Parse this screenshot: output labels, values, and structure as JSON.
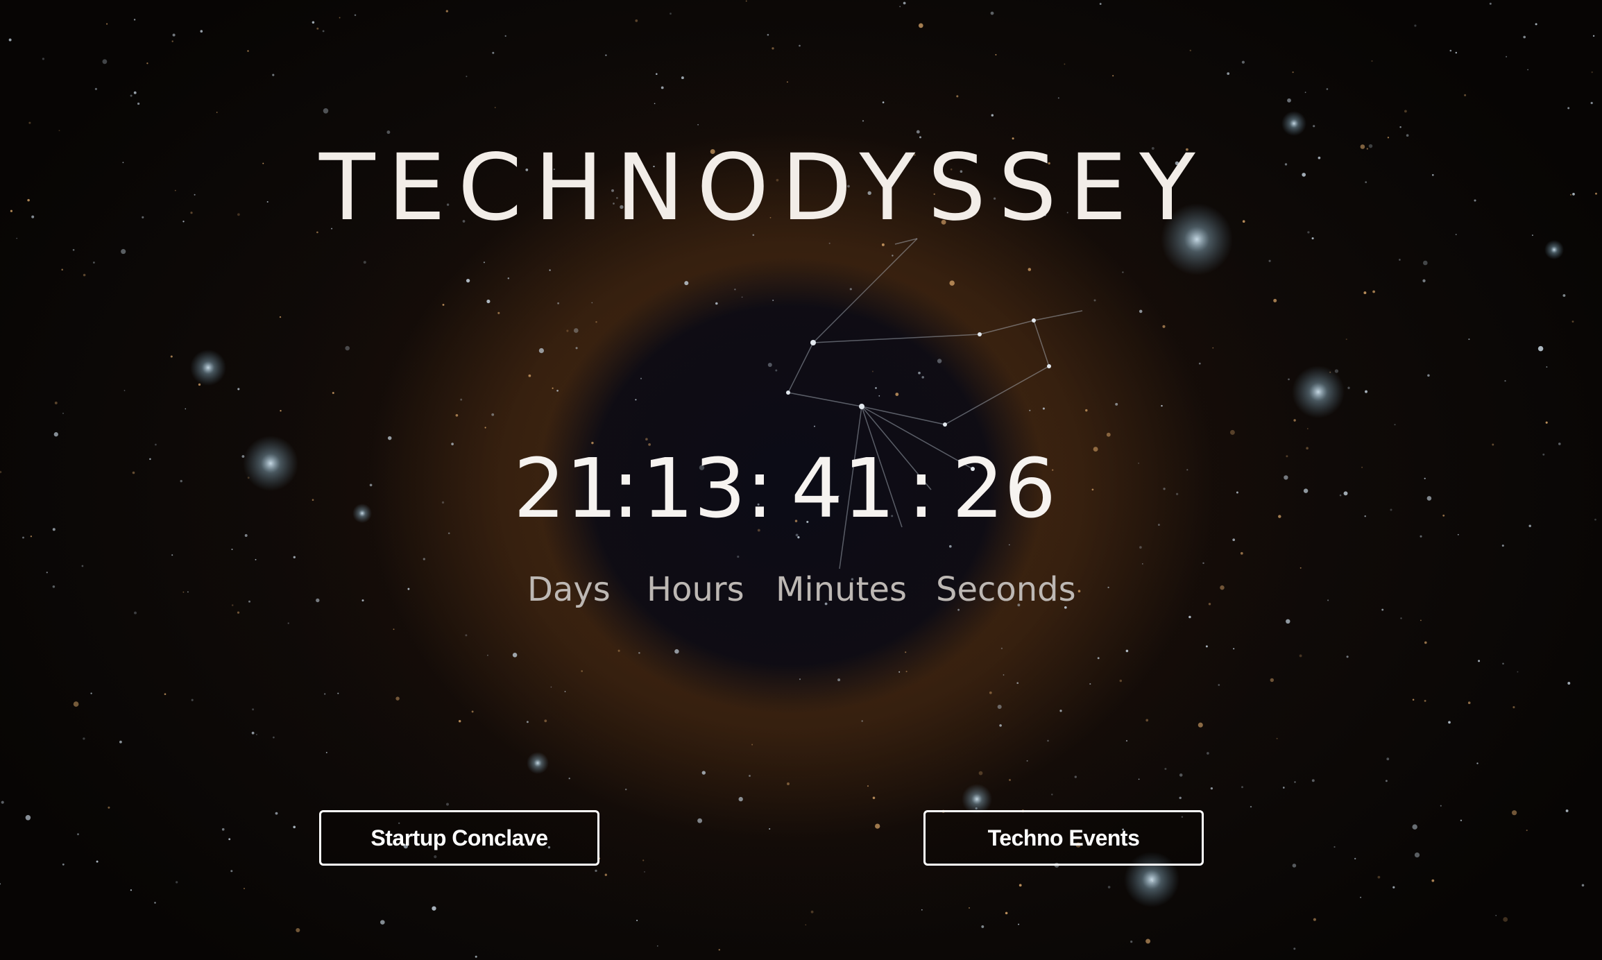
{
  "header": {
    "title": "TECHNODYSSEY"
  },
  "countdown": {
    "days": "21",
    "hours": "13",
    "minutes": "41",
    "seconds": "26",
    "separator": ":"
  },
  "countdown_labels": {
    "days": "Days",
    "hours": "Hours",
    "minutes": "Minutes",
    "seconds": "Seconds"
  },
  "actions": {
    "startup_label": "Startup Conclave",
    "techno_label": "Techno Events"
  },
  "colors": {
    "background": "#0b0806",
    "nebula": "#7a4a1e",
    "text": "#f2ede8",
    "label": "#bdb8b4",
    "button_border": "#ffffff"
  }
}
